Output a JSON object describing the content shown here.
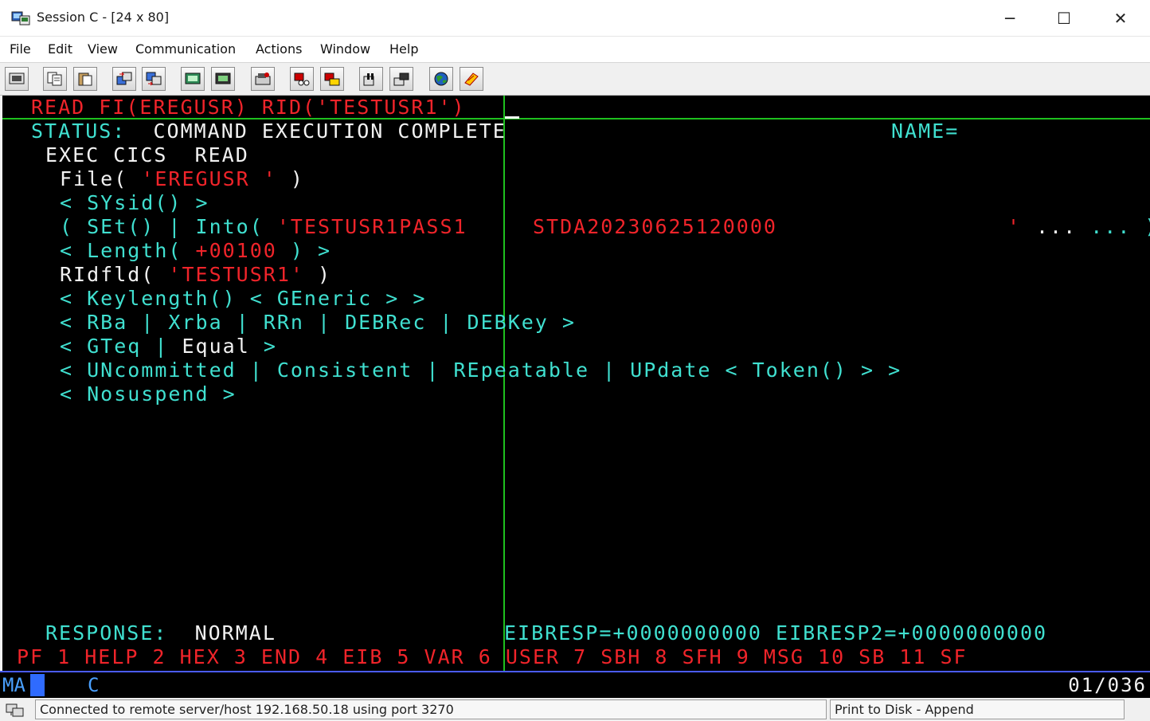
{
  "window": {
    "title": "Session C - [24 x 80]",
    "minimize": "─",
    "maximize": "☐",
    "close": "✕"
  },
  "menu": [
    "File",
    "Edit",
    "View",
    "Communication",
    "Actions",
    "Window",
    "Help"
  ],
  "toolbar": {
    "icons": [
      "print-screen-icon",
      "copy-icon",
      "paste-icon",
      "send-file-icon",
      "receive-file-icon",
      "display-setup-icon",
      "keyboard-map-icon",
      "macro-record-icon",
      "macro-play-icon",
      "macro-stop-icon",
      "pause-icon",
      "resume-icon",
      "web-icon",
      "script-icon"
    ]
  },
  "terminal": {
    "command": "READ FI(EREGUSR) RID('TESTUSR1')",
    "status_label": "STATUS:",
    "status_value": "COMMAND EXECUTION COMPLETE",
    "name_label": "NAME=",
    "exec_line": "EXEC CICS  READ",
    "file_prefix": "File(",
    "file_value": "'EREGUSR '",
    "file_suffix": ")",
    "sysid_line": "< SYsid() >",
    "set_into_prefix": "( SEt() | Into(",
    "into_value_1": "'TESTUSR1PASS1",
    "into_value_2": "STDA20230625120000",
    "into_value_end": "'",
    "set_into_suffix": "... ) )",
    "length_prefix": "< Length(",
    "length_value": "+00100",
    "length_suffix": ") >",
    "ridfld_prefix": "RIdfld(",
    "ridfld_value": "'TESTUSR1'",
    "ridfld_suffix": ")",
    "keylength_line": "< Keylength() < GEneric > >",
    "rba_line": "< RBa | Xrba | RRn | DEBRec | DEBKey >",
    "gteq_prefix": "< GTeq |",
    "gteq_equal": "Equal",
    "gteq_suffix": ">",
    "uncommitted_line": "< UNcommitted | Consistent | REpeatable | UPdate < Token() > >",
    "nosuspend_line": "< Nosuspend >",
    "response_label": "RESPONSE:",
    "response_value": "NORMAL",
    "eibresp": "EIBRESP=+0000000000 EIBRESP2=+0000000000",
    "pfkeys": "PF 1 HELP 2 HEX 3 END 4 EIB 5 VAR 6 USER 7 SBH 8 SFH 9 MSG 10 SB 11 SF"
  },
  "oia": {
    "mode": "MA",
    "session": "C",
    "cursor_position": "01/036"
  },
  "status": {
    "message": "Connected to remote server/host 192.168.50.18 using port 3270",
    "print": "Print to Disk - Append"
  }
}
